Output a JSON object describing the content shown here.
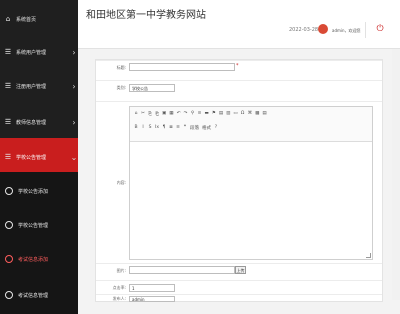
{
  "sidebar": {
    "items": [
      {
        "label": "系统首页",
        "icon": "home-icon"
      },
      {
        "label": "系统用户管理",
        "icon": "users-icon"
      },
      {
        "label": "注册用户管理",
        "icon": "user-plus-icon"
      },
      {
        "label": "教师信息管理",
        "icon": "teacher-icon"
      },
      {
        "label": "学校公告管理",
        "icon": "notice-icon"
      },
      {
        "label": "学校公告添加",
        "icon": "circle-arrow-icon"
      },
      {
        "label": "学校公告管理",
        "icon": "circle-arrow-icon"
      },
      {
        "label": "考试信息添加",
        "icon": "circle-arrow-icon"
      },
      {
        "label": "考试信息管理",
        "icon": "circle-arrow-icon"
      }
    ]
  },
  "header": {
    "site_title": "和田地区第一中学教务网站",
    "date": "2022-03-28",
    "user": "admin，欢迎您"
  },
  "form": {
    "title_label": "标题:",
    "title_value": "",
    "category_label": "类别:",
    "category_value": "学校公告",
    "content_label": "内容:",
    "image_label": "图片:",
    "upload_label": "上传",
    "clicks_label": "点击率:",
    "clicks_value": "1",
    "publisher_label": "发布人:",
    "publisher_value": "admin"
  },
  "editor": {
    "toolbar_row1": [
      "⌂",
      "✂",
      "⎘",
      "⎗",
      "▣",
      "▦",
      "↶",
      "↷",
      "⚲",
      "≡",
      "▬",
      "⚑",
      "▤",
      "▥",
      "▭",
      "Ω",
      "⌘",
      "▩",
      "▤"
    ],
    "toolbar_row2": [
      "B",
      "I",
      "S",
      "Ix",
      "¶",
      "≣",
      "≡",
      "❞",
      "段落",
      "格式",
      "?"
    ]
  },
  "colors": {
    "accent": "#c91e1e",
    "sidebar_bg": "#1f1f1f"
  }
}
